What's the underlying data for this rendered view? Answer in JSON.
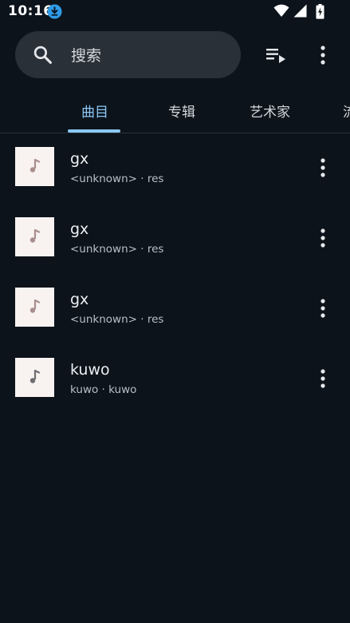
{
  "status_bar": {
    "time": "10:16",
    "download_badge_icon": "download-badge-icon",
    "wifi_icon": "wifi-icon",
    "signal_icon": "cell-signal-icon",
    "battery_icon": "battery-charging-icon"
  },
  "search": {
    "placeholder": "搜索",
    "icon": "search-icon"
  },
  "toolbar": {
    "queue_icon": "playlist-play-icon",
    "more_icon": "more-vert-icon"
  },
  "tabs": [
    {
      "label": "曲目",
      "active": true
    },
    {
      "label": "专辑",
      "active": false
    },
    {
      "label": "艺术家",
      "active": false
    },
    {
      "label": "流",
      "active": false
    }
  ],
  "songs": [
    {
      "title": "gx",
      "subtitle": "<unknown> · res",
      "note_color": "#a88e8c"
    },
    {
      "title": "gx",
      "subtitle": "<unknown> · res",
      "note_color": "#a88e8c"
    },
    {
      "title": "gx",
      "subtitle": "<unknown> · res",
      "note_color": "#a88e8c"
    },
    {
      "title": "kuwo",
      "subtitle": "kuwo · kuwo",
      "note_color": "#6e6e72"
    }
  ],
  "colors": {
    "background": "#0c131b",
    "search_bg": "#2a3038",
    "accent": "#8ac8f5",
    "download_badge": "#2f9be8"
  }
}
